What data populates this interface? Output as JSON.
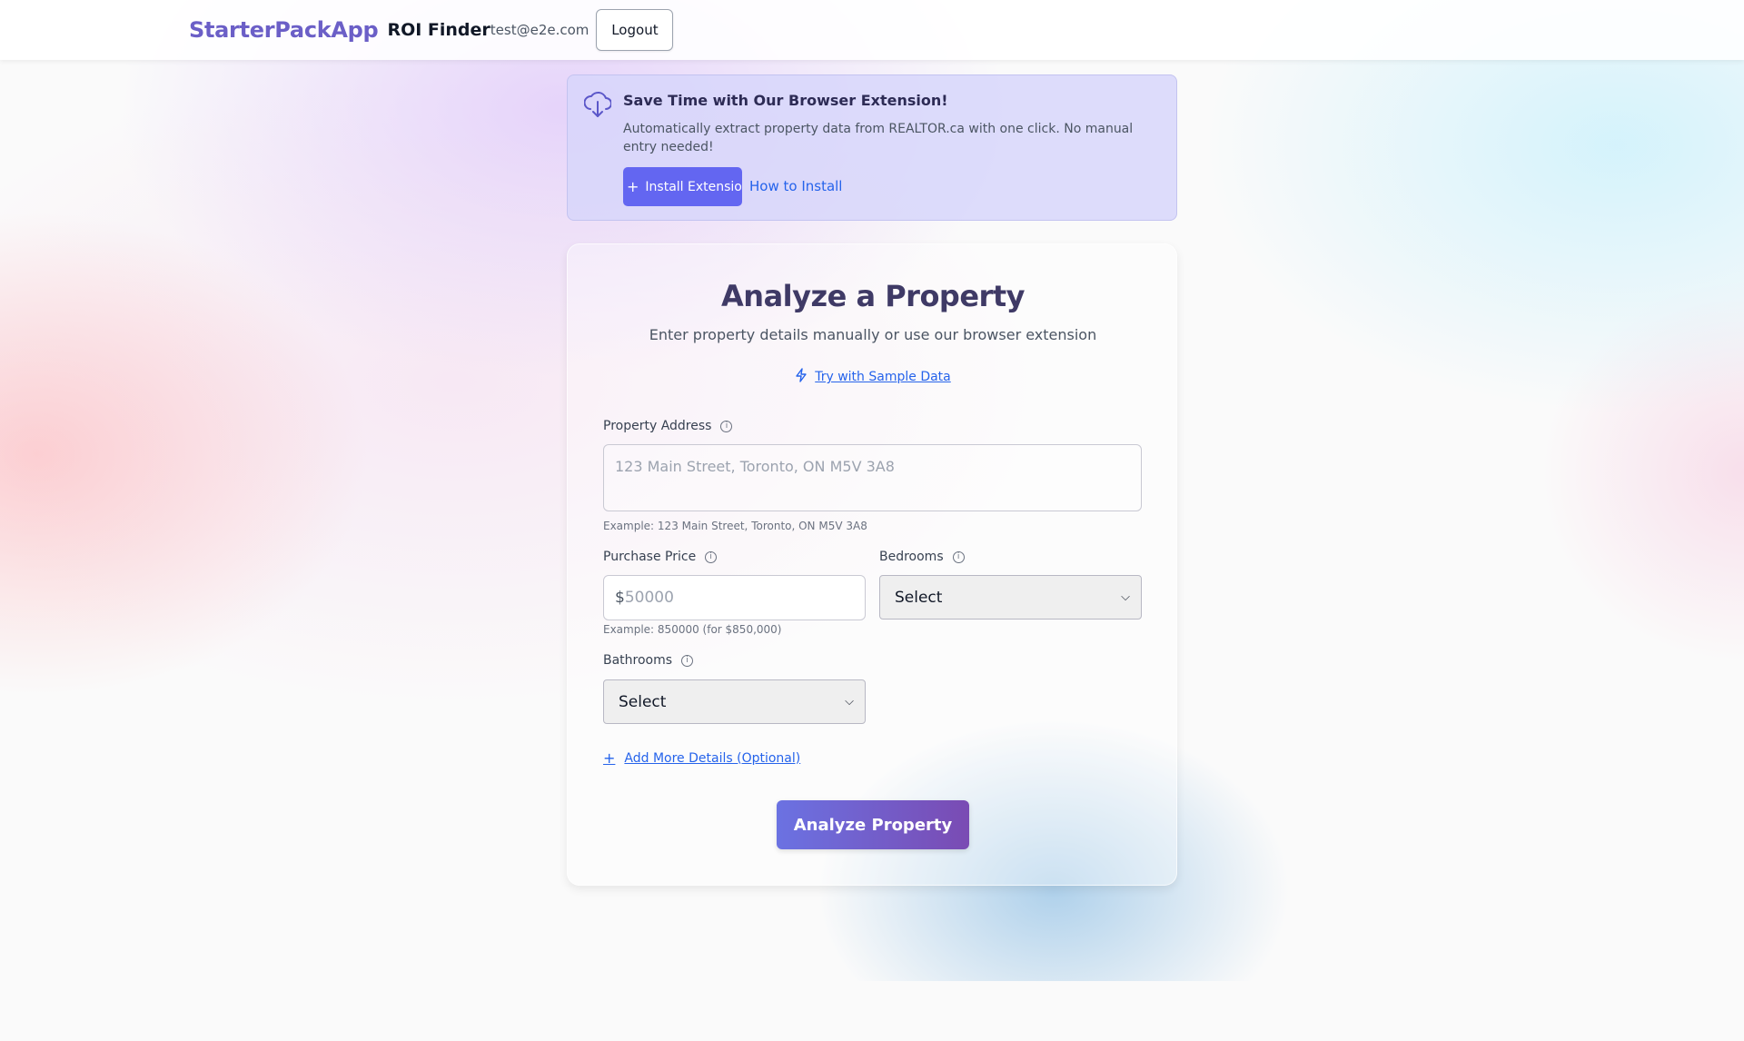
{
  "header": {
    "brand": "StarterPackApp",
    "app_title": "ROI Finder",
    "user_email": "test@e2e.com",
    "logout_label": "Logout"
  },
  "banner": {
    "title": "Save Time with Our Browser Extension!",
    "text": "Automatically extract property data from REALTOR.ca with one click. No manual entry needed!",
    "install_label": "Install Extension",
    "howto_label": "How to Install",
    "icon": "cloud-download-icon"
  },
  "form": {
    "title": "Analyze a Property",
    "subtitle": "Enter property details manually or use our browser extension",
    "sample_label": "Try with Sample Data",
    "address": {
      "label": "Property Address",
      "placeholder": "123 Main Street, Toronto, ON M5V 3A8",
      "value": "",
      "hint": "Example: 123 Main Street, Toronto, ON M5V 3A8"
    },
    "price": {
      "label": "Purchase Price",
      "currency": "$",
      "placeholder": "50000",
      "value": "",
      "hint": "Example: 850000 (for $850,000)"
    },
    "bedrooms": {
      "label": "Bedrooms",
      "selected": "Select"
    },
    "bathrooms": {
      "label": "Bathrooms",
      "selected": "Select"
    },
    "add_more_label": "Add More Details (Optional)",
    "submit_label": "Analyze Property"
  },
  "colors": {
    "brand": "#6b5fc7",
    "accent": "#6366f1",
    "link": "#2563eb"
  }
}
